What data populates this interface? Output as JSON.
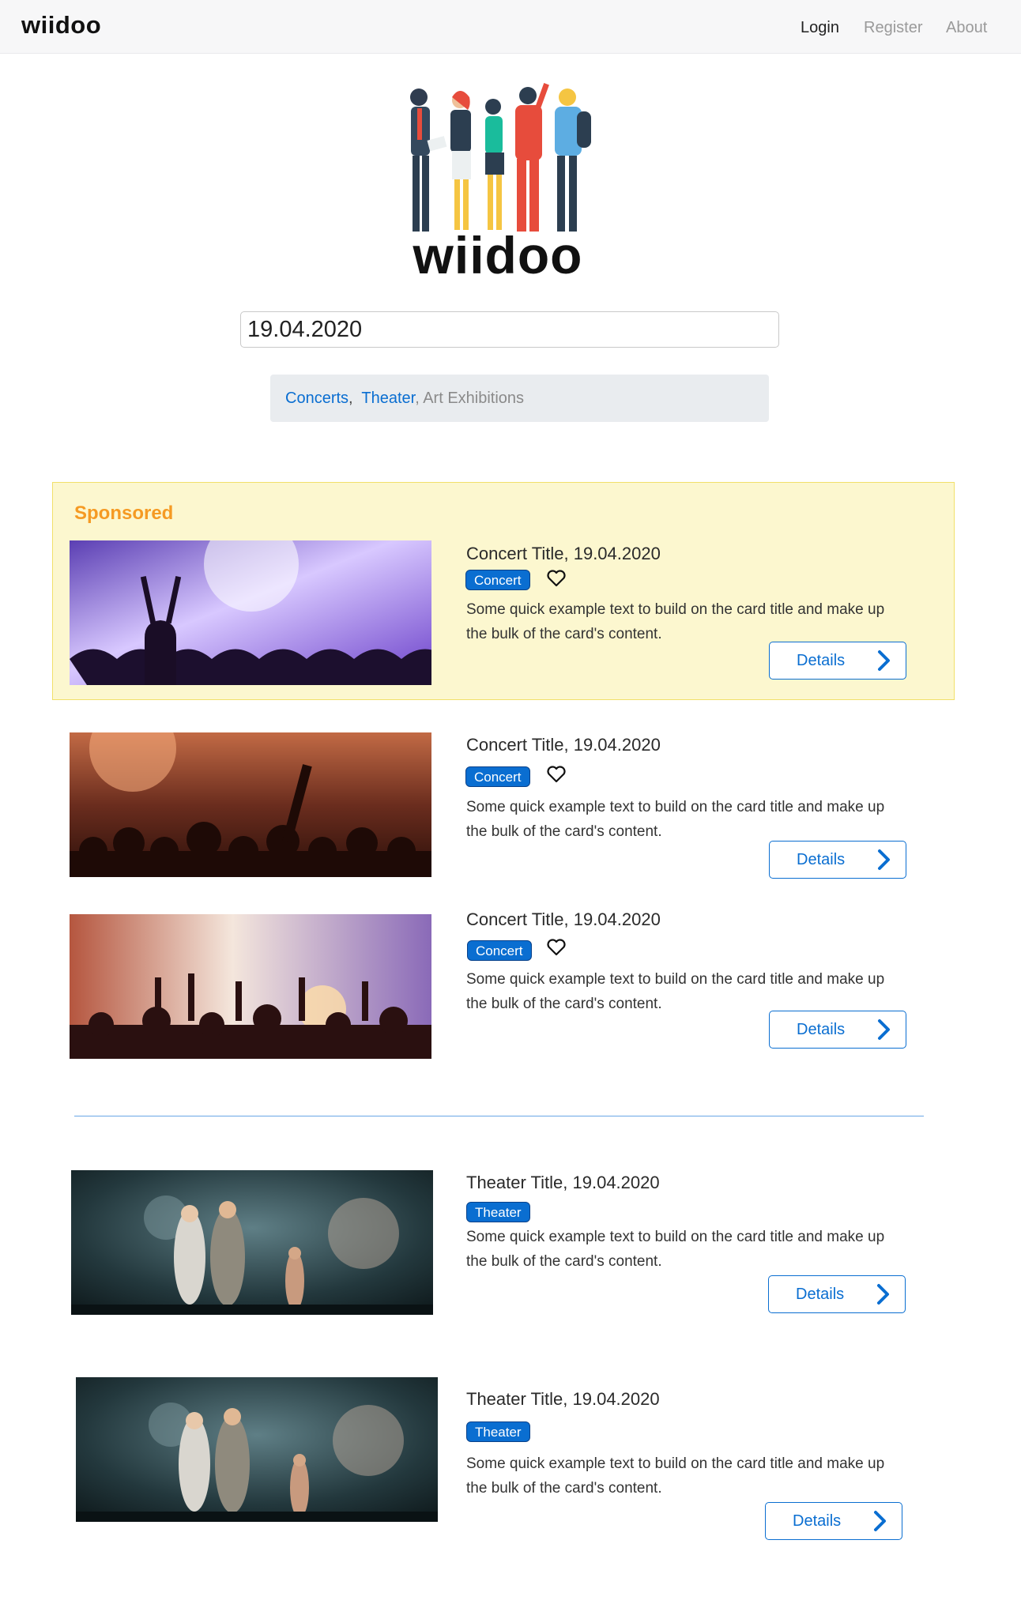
{
  "navbar": {
    "brand": "wiidoo",
    "login": "Login",
    "register": "Register",
    "about": "About"
  },
  "hero": {
    "wordmark": "wiidoo"
  },
  "search": {
    "date_value": "19.04.2020"
  },
  "filters": {
    "concerts": "Concerts",
    "sep1": ",",
    "theater": "Theater",
    "sep2": ",",
    "art": " Art Exhibitions"
  },
  "sponsored_label": "Sponsored",
  "cards": [
    {
      "title": "Concert Title, 19.04.2020",
      "badge": "Concert",
      "favorite_icon": "heart-outline-icon",
      "text_line1": "Some quick example text to build on the card title and make up",
      "text_line2": "the bulk of the card's content.",
      "button": "Details",
      "sponsored": true
    },
    {
      "title": "Concert Title, 19.04.2020",
      "badge": "Concert",
      "favorite_icon": "heart-outline-icon",
      "text_line1": "Some quick example text to build on the card title and make up",
      "text_line2": "the bulk of the card's content.",
      "button": "Details",
      "sponsored": false
    },
    {
      "title": "Concert Title, 19.04.2020",
      "badge": "Concert",
      "favorite_icon": "heart-outline-icon",
      "text_line1": "Some quick example text to build on the card title and make up",
      "text_line2": "the bulk of the card's content.",
      "button": "Details",
      "sponsored": false
    },
    {
      "title": "Theater Title, 19.04.2020",
      "badge": "Theater",
      "text_line1": "Some quick example text to build on the card title and make up",
      "text_line2": "the bulk of the card's content.",
      "button": "Details",
      "sponsored": false
    },
    {
      "title": "Theater Title, 19.04.2020",
      "badge": "Theater",
      "text_line1": "Some quick example text to build on the card title and make up",
      "text_line2": "the bulk of the card's content.",
      "button": "Details",
      "sponsored": false
    }
  ],
  "colors": {
    "accent": "#0a6ed1",
    "sponsored_bg": "#fcf7cf",
    "sponsored_label": "#f59a23",
    "navbar_bg": "#f7f7f8"
  }
}
